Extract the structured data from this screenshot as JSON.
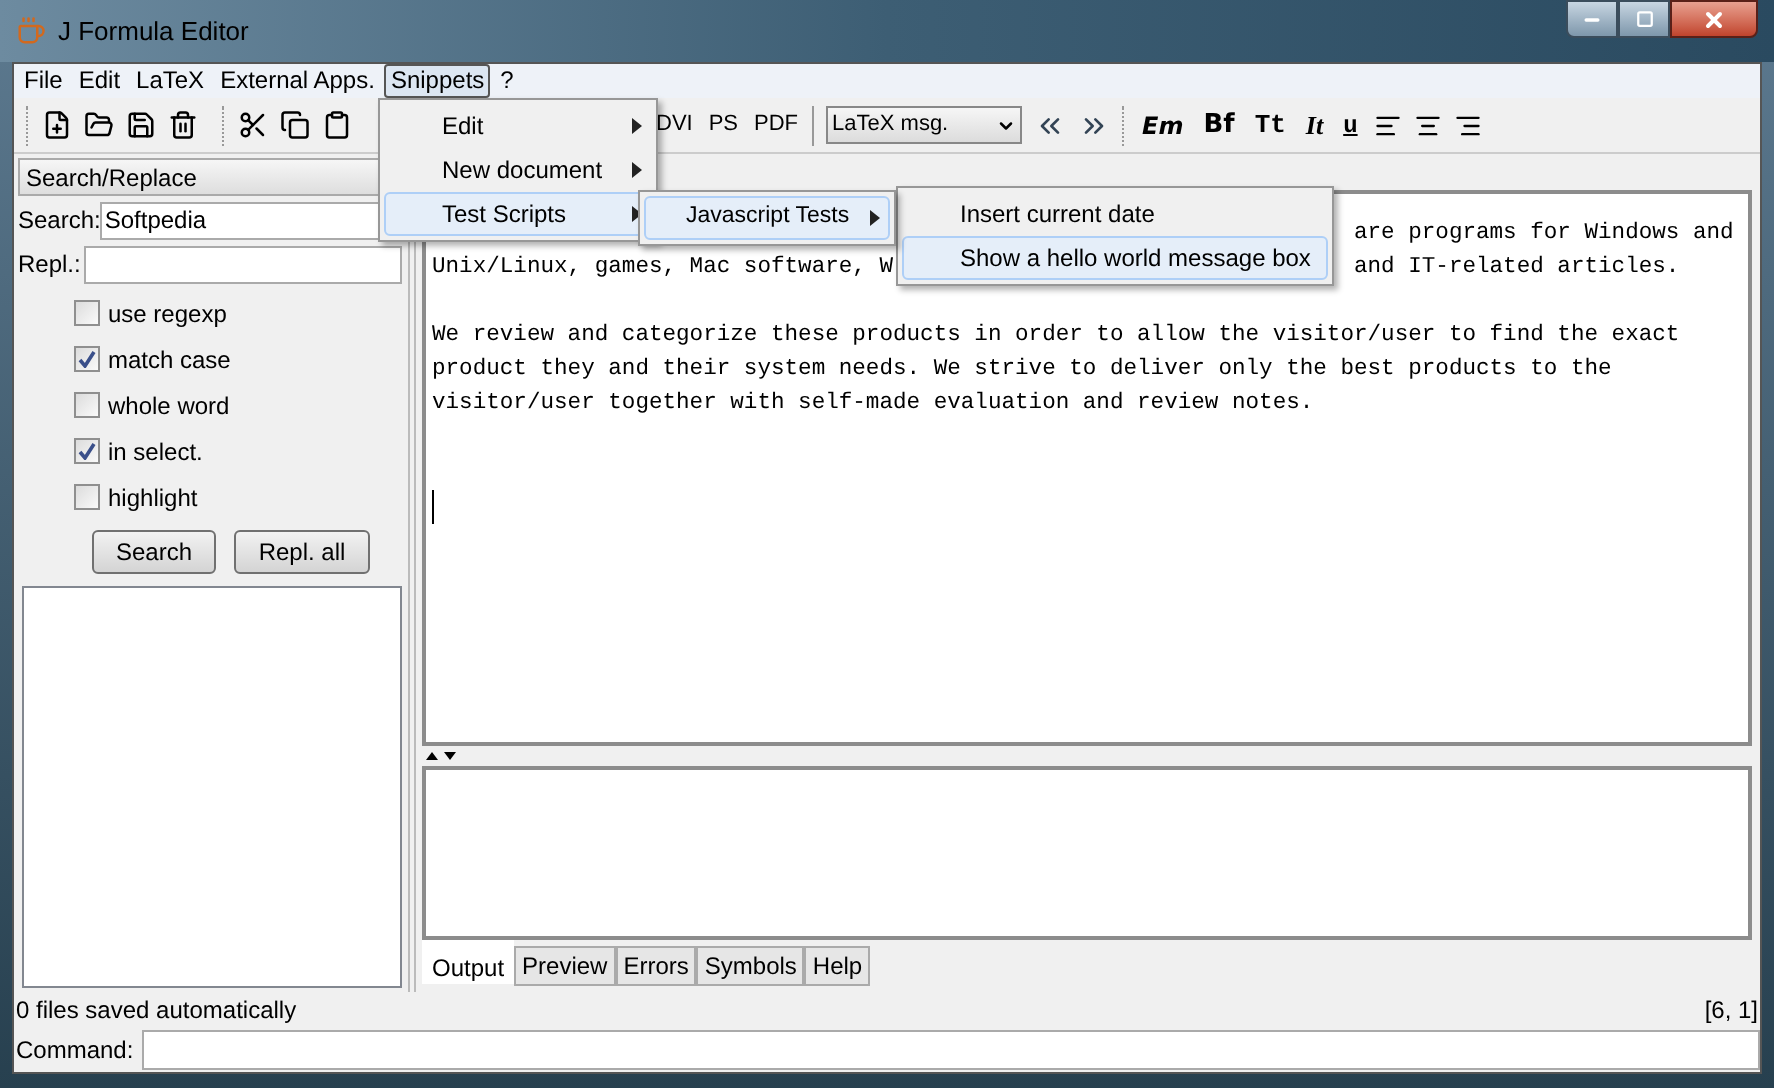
{
  "window": {
    "title": "J Formula Editor"
  },
  "menu_bar": [
    {
      "label": "File",
      "selected": false
    },
    {
      "label": "Edit",
      "selected": false
    },
    {
      "label": "LaTeX",
      "selected": false
    },
    {
      "label": "External Apps.",
      "selected": false
    },
    {
      "label": "Snippets",
      "selected": true
    },
    {
      "label": "?",
      "selected": false
    }
  ],
  "toolbar": {
    "output_buttons": [
      "DVI",
      "PS",
      "PDF"
    ],
    "log_select": {
      "value": "LaTeX msg."
    },
    "format_buttons": [
      {
        "label": "Em",
        "kind": "em"
      },
      {
        "label": "Bf",
        "kind": "bold"
      },
      {
        "label": "Tt",
        "kind": "mono"
      },
      {
        "label": "It",
        "kind": "italic"
      },
      {
        "label": "u",
        "kind": "underline"
      }
    ]
  },
  "side_panel": {
    "mode_select": {
      "value": "Search/Replace"
    },
    "search": {
      "label": "Search:",
      "value": "Softpedia"
    },
    "replace": {
      "label": "Repl.:"
    },
    "options": [
      {
        "label": "use regexp",
        "checked": false
      },
      {
        "label": "match case",
        "checked": true
      },
      {
        "label": "whole word",
        "checked": false
      },
      {
        "label": "in select.",
        "checked": true
      },
      {
        "label": "highlight",
        "checked": false
      }
    ],
    "buttons": [
      "Search",
      "Repl. all"
    ]
  },
  "editor": {
    "paragraphs": [
      [
        {
          "parts": [
            "are programs for Windows and"
          ]
        },
        {
          "parts": [
            "Unix/Linux, games, Mac software, W",
            "and IT-related articles."
          ]
        }
      ],
      [
        {
          "parts": [
            "We review and categorize these products in order to allow the visitor/user to find the exact"
          ]
        },
        {
          "parts": [
            "product they and their system needs. We strive to deliver only the best products to the"
          ]
        },
        {
          "parts": [
            "visitor/user together with self-made evaluation and review notes."
          ]
        }
      ]
    ]
  },
  "bottom_tabs": [
    {
      "label": "Output",
      "selected": true
    },
    {
      "label": "Preview",
      "selected": false
    },
    {
      "label": "Errors",
      "selected": false
    },
    {
      "label": "Symbols",
      "selected": false
    },
    {
      "label": "Help",
      "selected": false
    }
  ],
  "status_bar": {
    "message": "0 files saved automatically",
    "position": "[6, 1]"
  },
  "command": {
    "label": "Command:"
  },
  "menus": {
    "snippets": [
      {
        "label": "Edit",
        "selected": false,
        "has_submenu": true
      },
      {
        "label": "New document",
        "selected": false,
        "has_submenu": true
      },
      {
        "label": "Test Scripts",
        "selected": true,
        "has_submenu": true
      }
    ],
    "test_scripts": [
      {
        "label": "Javascript Tests",
        "selected": true,
        "has_submenu": true
      }
    ],
    "javascript_tests": [
      {
        "label": "Insert current date",
        "selected": false,
        "has_submenu": false
      },
      {
        "label": "Show a hello world message box",
        "selected": true,
        "has_submenu": false
      }
    ]
  }
}
